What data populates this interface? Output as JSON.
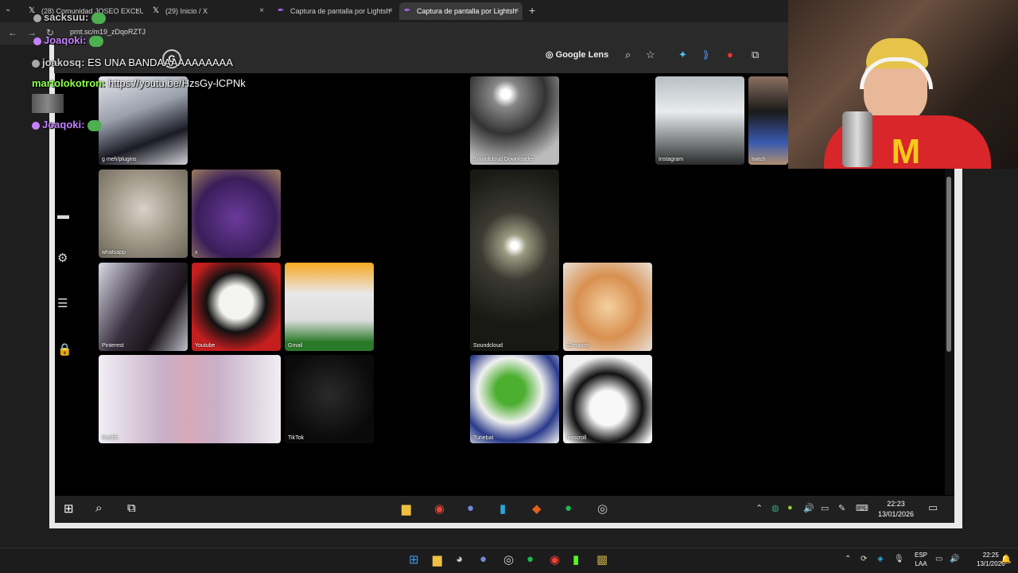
{
  "browser": {
    "tabs": [
      {
        "label": "(28) Comunidad JOSEO EXCLUSI",
        "icon": "x-logo-icon",
        "active": false
      },
      {
        "label": "(29) Inicio / X",
        "icon": "x-logo-icon",
        "active": false
      },
      {
        "label": "Captura de pantalla por Lightsh",
        "icon": "lightshot-icon",
        "active": false
      },
      {
        "label": "Captura de pantalla por Lightsh",
        "icon": "lightshot-icon",
        "active": true
      }
    ],
    "new_tab": "+",
    "close": "×",
    "url": "prnt.sc/m19_zDqoRZTJ"
  },
  "inner_browser": {
    "lens_label": "Google Lens",
    "search_letter": "G"
  },
  "tiles": [
    {
      "label": "g meh/plugins",
      "color": "#4a5568"
    },
    {
      "label": "whatsapp",
      "color": "#8a8070"
    },
    {
      "label": "x",
      "color": "#4b2c6e"
    },
    {
      "label": "Pinterest",
      "color": "#3a3a46"
    },
    {
      "label": "Youtube",
      "color": "#c22"
    },
    {
      "label": "Gmail",
      "color": "#2a5ca8"
    },
    {
      "label": "Reddit",
      "color": "#e0d0e0"
    },
    {
      "label": "TikTok",
      "color": "#111"
    },
    {
      "label": "Soundcloud Downloader",
      "color": "#555"
    },
    {
      "label": "Soundcloud",
      "color": "#222"
    },
    {
      "label": "Tunebat",
      "color": "#eee"
    },
    {
      "label": "Instagram",
      "color": "#6a6e70"
    },
    {
      "label": "twitch",
      "color": "#b0a090"
    },
    {
      "label": "12manos",
      "color": "#c89060"
    },
    {
      "label": "lexscroll",
      "color": "#f0f0f0"
    }
  ],
  "chat": [
    {
      "user": "sacksuu:",
      "color": "#cfcfcf",
      "msg": ""
    },
    {
      "user": "Joaqoki:",
      "color": "#c580ff",
      "msg": ""
    },
    {
      "user": "joakosq:",
      "color": "#d0d0d0",
      "msg": "ES UNA BANDAAAAAAAAAAA"
    },
    {
      "user": "martolokotron:",
      "color": "#8bff4b",
      "msg": "https://youtu.be/HzsGy-lCPNk"
    },
    {
      "user": "Joaqoki:",
      "color": "#c580ff",
      "msg": ""
    }
  ],
  "inner_clock": {
    "time": "22:23",
    "date": "13/01/2026"
  },
  "taskbar": {
    "lang_top": "ESP",
    "lang_bottom": "LAA",
    "time": "22:25",
    "date": "13/1/2026"
  }
}
